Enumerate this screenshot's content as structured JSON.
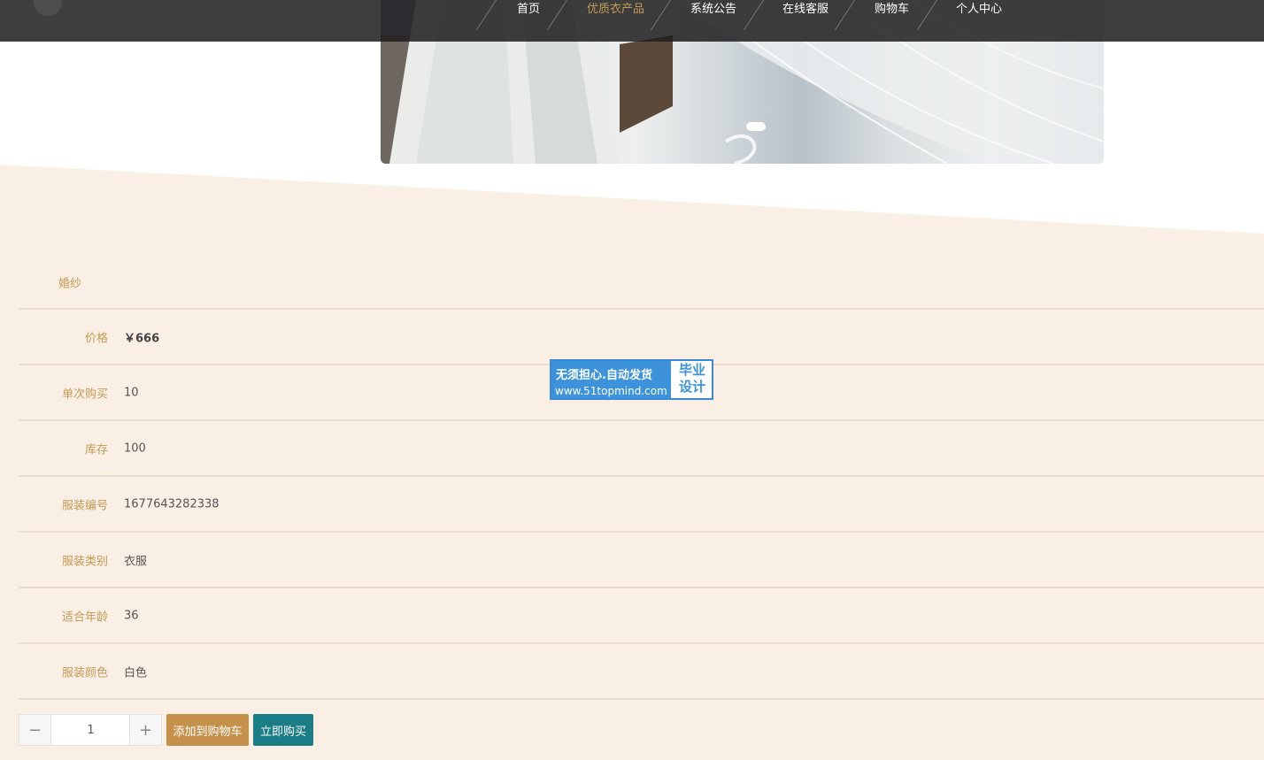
{
  "nav": {
    "items": [
      {
        "label": "首页"
      },
      {
        "label": "优质衣产品"
      },
      {
        "label": "系统公告"
      },
      {
        "label": "在线客服"
      },
      {
        "label": "购物车"
      },
      {
        "label": "个人中心"
      }
    ],
    "active_index": 1
  },
  "product": {
    "name": "婚纱",
    "fields": [
      {
        "label": "价格",
        "value": "￥666"
      },
      {
        "label": "单次购买",
        "value": "10"
      },
      {
        "label": "库存",
        "value": "100"
      },
      {
        "label": "服装编号",
        "value": "1677643282338"
      },
      {
        "label": "服装类别",
        "value": "衣服"
      },
      {
        "label": "适合年龄",
        "value": "36"
      },
      {
        "label": "服装颜色",
        "value": "白色"
      }
    ]
  },
  "actions": {
    "quantity": "1",
    "minus_symbol": "−",
    "plus_symbol": "+",
    "add_to_cart_label": "添加到购物车",
    "buy_now_label": "立即购买"
  },
  "watermark": {
    "line1": "无须担心.自动发货",
    "line2": "www.51topmind.com",
    "side": "毕业\n设计"
  },
  "colors": {
    "accent": "#c49a55",
    "cart_button": "#c4904a",
    "buy_button": "#1b7e86",
    "background": "#f9efe4"
  }
}
